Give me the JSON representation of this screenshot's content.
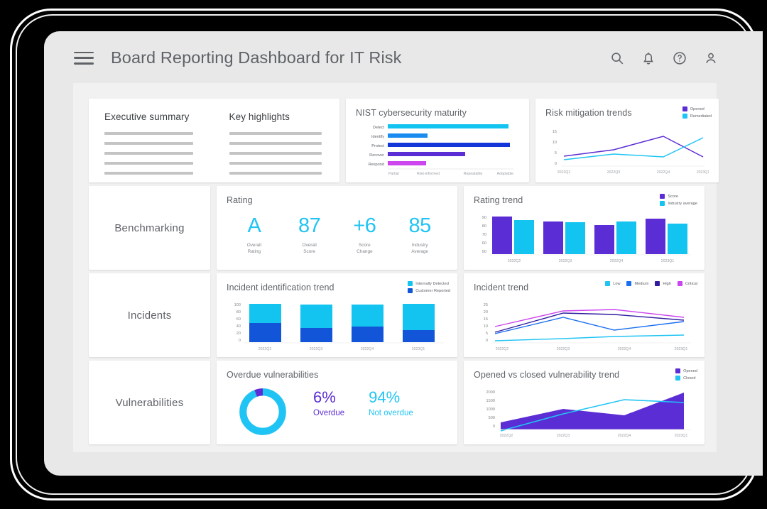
{
  "header": {
    "title": "Board Reporting Dashboard for IT Risk",
    "menu_icon": "hamburger-menu-icon",
    "icons": [
      "search-icon",
      "notification-bell-icon",
      "help-circle-icon",
      "user-account-icon"
    ]
  },
  "colors": {
    "cyan": "#20c4f4",
    "blue": "#1255d8",
    "indigo": "#2f1d9e",
    "purple": "#5b2dd4",
    "magenta": "#cc44ee",
    "bright_cyan": "#13c4f0",
    "text_gray": "#5f6368",
    "placeholder_gray": "#c4c4c4"
  },
  "summary": {
    "executive_summary_title": "Executive summary",
    "key_highlights_title": "Key highlights",
    "placeholder_line_count": 5
  },
  "categories": [
    {
      "label": "Benchmarking"
    },
    {
      "label": "Incidents"
    },
    {
      "label": "Vulnerabilities"
    }
  ],
  "rating": {
    "title": "Rating",
    "metrics": [
      {
        "value": "A",
        "caption_line1": "Overall",
        "caption_line2": "Rating"
      },
      {
        "value": "87",
        "caption_line1": "Overall",
        "caption_line2": "Score"
      },
      {
        "value": "+6",
        "caption_line1": "Score",
        "caption_line2": "Change"
      },
      {
        "value": "85",
        "caption_line1": "Industry",
        "caption_line2": "Average"
      }
    ]
  },
  "overdue": {
    "title": "Overdue vulnerabilities",
    "overdue_value": "6%",
    "overdue_caption": "Overdue",
    "not_overdue_value": "94%",
    "not_overdue_caption": "Not overdue"
  },
  "chart_data": [
    {
      "id": "nist",
      "type": "bar",
      "orientation": "horizontal",
      "title": "NIST cybersecurity maturity",
      "categories": [
        "Detect",
        "Identify",
        "Protect",
        "Recover",
        "Respond"
      ],
      "values": [
        3.85,
        1.25,
        3.9,
        2.45,
        1.2
      ],
      "colors": [
        "#13c4f0",
        "#1a8cf0",
        "#1236d8",
        "#5b2dd4",
        "#cc44ee"
      ],
      "xlabel": "",
      "ylabel": "",
      "xticks": [
        "Partial",
        "Risk-informed",
        "Repeatable",
        "Adaptable"
      ],
      "xlim": [
        0,
        4
      ],
      "grid": false,
      "legend": "none"
    },
    {
      "id": "risk_mitigation",
      "type": "line",
      "title": "Risk mitigation trends",
      "categories": [
        "2022Q2",
        "2022Q3",
        "2022Q4",
        "2023Q1"
      ],
      "series": [
        {
          "name": "Opened",
          "values": [
            3.2,
            6.3,
            12.6,
            4.2
          ],
          "color": "#5b2dd4"
        },
        {
          "name": "Remediated",
          "values": [
            1.6,
            4.2,
            2.9,
            11.6
          ],
          "color": "#20c4f4"
        }
      ],
      "yticks": [
        0,
        5,
        10,
        15
      ],
      "ylim": [
        0,
        15
      ],
      "grid": false,
      "legend": "top-right"
    },
    {
      "id": "rating_trend",
      "type": "bar",
      "title": "Rating trend",
      "categories": [
        "2022Q2",
        "2022Q3",
        "2022Q4",
        "2023Q1"
      ],
      "series": [
        {
          "name": "Score",
          "values": [
            90,
            85,
            81,
            88
          ],
          "color": "#5b2dd4"
        },
        {
          "name": "Industry average",
          "values": [
            86,
            84,
            85,
            83
          ],
          "color": "#13c4f0"
        }
      ],
      "yticks": [
        50,
        60,
        70,
        80,
        90
      ],
      "ylim": [
        50,
        92
      ],
      "grid": false,
      "legend": "top-right"
    },
    {
      "id": "incident_identification",
      "type": "bar",
      "stacked": true,
      "title": "Incident identification trend",
      "categories": [
        "2022Q2",
        "2022Q3",
        "2022Q4",
        "2023Q1"
      ],
      "series": [
        {
          "name": "Customer Reported",
          "values": [
            51,
            40,
            43,
            34
          ],
          "color": "#1255d8"
        },
        {
          "name": "Internally Detected",
          "values": [
            54,
            65,
            62,
            71
          ],
          "color": "#13c4f0"
        }
      ],
      "yticks": [
        0,
        20,
        40,
        60,
        80,
        100
      ],
      "ylim": [
        0,
        108
      ],
      "grid": false,
      "legend": "top-right"
    },
    {
      "id": "incident_trend",
      "type": "line",
      "title": "Incident trend",
      "categories": [
        "2022Q2",
        "2022Q3",
        "2022Q4",
        "2023Q1"
      ],
      "series": [
        {
          "name": "Low",
          "values": [
            1.2,
            2.4,
            3.6,
            5.3
          ],
          "color": "#20c4f4"
        },
        {
          "name": "Medium",
          "values": [
            6.0,
            17.5,
            8.6,
            14.7
          ],
          "color": "#1a6ef0"
        },
        {
          "name": "High",
          "values": [
            7.2,
            20.8,
            19.4,
            16.0
          ],
          "color": "#2f1d9e"
        },
        {
          "name": "Critical",
          "values": [
            11.2,
            22.2,
            23.4,
            18.4
          ],
          "color": "#cc44ee"
        }
      ],
      "yticks": [
        0,
        5,
        10,
        15,
        20,
        25
      ],
      "ylim": [
        0,
        26
      ],
      "grid": false,
      "legend": "top-right-horizontal"
    },
    {
      "id": "opened_vs_closed",
      "type": "area",
      "title": "Opened vs closed vulnerability trend",
      "categories": [
        "2022Q2",
        "2022Q3",
        "2022Q4",
        "2023Q1"
      ],
      "series": [
        {
          "name": "Opened",
          "values": [
            330,
            1090,
            730,
            1720
          ],
          "color": "#5b2dd4"
        },
        {
          "name": "Closed",
          "values": [
            -130,
            780,
            1620,
            1420
          ],
          "color": "#20c4f4"
        }
      ],
      "yticks": [
        0,
        500,
        1000,
        1500,
        2000
      ],
      "ylim": [
        -200,
        2000
      ],
      "grid": false,
      "legend": "top-right"
    },
    {
      "id": "overdue_donut",
      "type": "pie",
      "title": "Overdue vulnerabilities",
      "categories": [
        "Overdue",
        "Not overdue"
      ],
      "values": [
        6,
        94
      ],
      "colors": [
        "#5b2dd4",
        "#20c4f4"
      ],
      "legend": "none"
    }
  ]
}
